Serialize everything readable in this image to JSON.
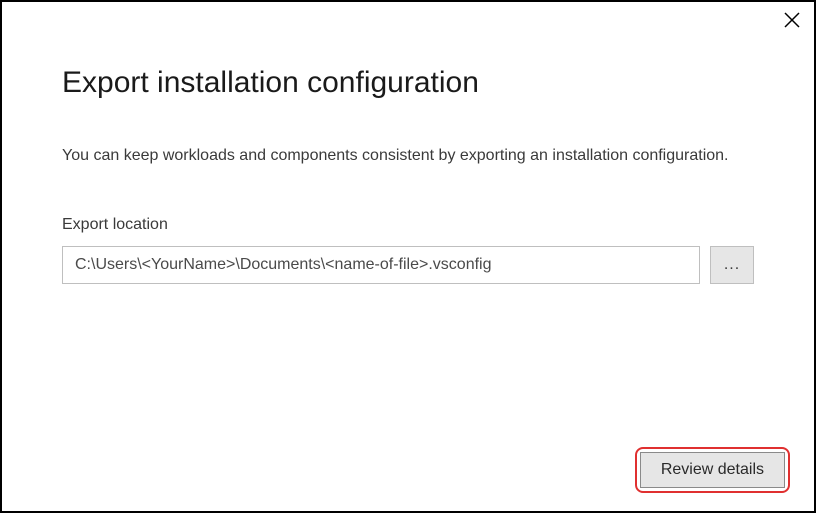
{
  "dialog": {
    "title": "Export installation configuration",
    "description": "You can keep workloads and components consistent by exporting an installation configuration.",
    "field_label": "Export location",
    "path_value": "C:\\Users\\<YourName>\\Documents\\<name-of-file>.vsconfig",
    "browse_label": "...",
    "review_label": "Review details"
  }
}
